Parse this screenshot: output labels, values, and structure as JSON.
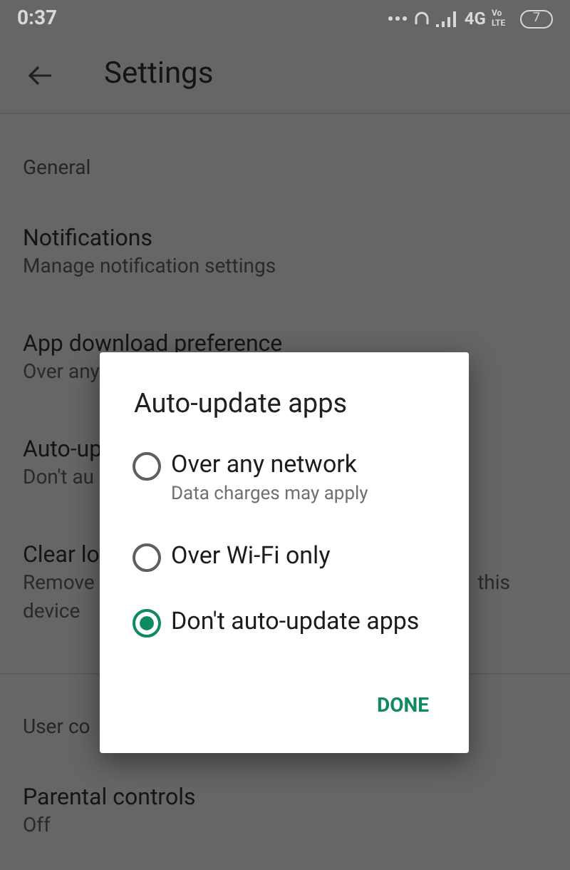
{
  "status_bar": {
    "time": "0:37",
    "network": "4G",
    "volte": "Vo LTE",
    "battery": "7"
  },
  "app_bar": {
    "title": "Settings"
  },
  "sections": [
    {
      "header": "General",
      "items": [
        {
          "title": "Notifications",
          "subtitle": "Manage notification settings"
        },
        {
          "title": "App download preference",
          "subtitle": "Over any"
        },
        {
          "title": "Auto-up",
          "subtitle": "Don't au"
        },
        {
          "title": "Clear lo",
          "subtitle": "Remove",
          "subtitle_right": "this",
          "subtitle_2": "device"
        }
      ]
    },
    {
      "header": "User co",
      "items": [
        {
          "title": "Parental controls",
          "subtitle": "Off"
        }
      ]
    }
  ],
  "dialog": {
    "title": "Auto-update apps",
    "options": [
      {
        "label": "Over any network",
        "subtitle": "Data charges may apply",
        "selected": false
      },
      {
        "label": "Over Wi-Fi only",
        "selected": false
      },
      {
        "label": "Don't auto-update apps",
        "selected": true
      }
    ],
    "button": "DONE"
  }
}
